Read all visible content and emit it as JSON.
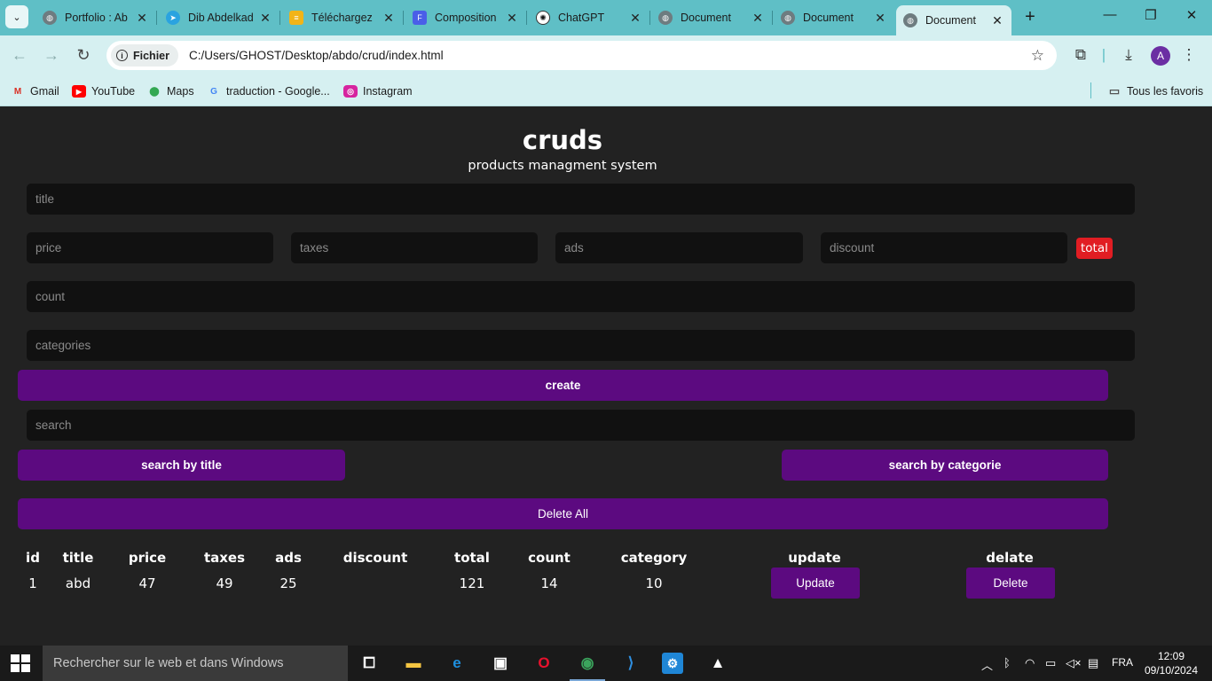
{
  "browser": {
    "tabs": [
      {
        "title": "Portfolio : Ab",
        "icon": "globe-icon",
        "active": false
      },
      {
        "title": "Dib Abdelkad",
        "icon": "telegram-icon",
        "active": false
      },
      {
        "title": "Téléchargez",
        "icon": "download-site-icon",
        "active": false
      },
      {
        "title": "Composition",
        "icon": "forms-icon",
        "active": false
      },
      {
        "title": "ChatGPT",
        "icon": "chatgpt-icon",
        "active": false
      },
      {
        "title": "Document",
        "icon": "globe-icon",
        "active": false
      },
      {
        "title": "Document",
        "icon": "globe-icon",
        "active": false
      },
      {
        "title": "Document",
        "icon": "globe-icon",
        "active": true
      }
    ],
    "address": {
      "chip_label": "Fichier",
      "url": "C:/Users/GHOST/Desktop/abdo/crud/index.html"
    },
    "profile_initial": "A",
    "bookmarks": [
      {
        "label": "Gmail",
        "icon": "gmail-icon"
      },
      {
        "label": "YouTube",
        "icon": "youtube-icon"
      },
      {
        "label": "Maps",
        "icon": "maps-icon"
      },
      {
        "label": "traduction - Google...",
        "icon": "google-icon"
      },
      {
        "label": "Instagram",
        "icon": "instagram-icon"
      }
    ],
    "all_bookmarks_label": "Tous les favoris"
  },
  "page": {
    "title": "cruds",
    "subtitle": "products managment system",
    "inputs": {
      "title_placeholder": "title",
      "price_placeholder": "price",
      "taxes_placeholder": "taxes",
      "ads_placeholder": "ads",
      "discount_placeholder": "discount",
      "count_placeholder": "count",
      "categories_placeholder": "categories",
      "search_placeholder": "search"
    },
    "total_badge": "total",
    "buttons": {
      "create": "create",
      "search_by_title": "search by title",
      "search_by_category": "search by categorie",
      "delete_all": "Delete All"
    },
    "table": {
      "headers": [
        "id",
        "title",
        "price",
        "taxes",
        "ads",
        "discount",
        "total",
        "count",
        "category",
        "update",
        "delate"
      ],
      "rows": [
        {
          "id": "1",
          "title": "abd",
          "price": "47",
          "taxes": "49",
          "ads": "25",
          "discount": "",
          "total": "121",
          "count": "14",
          "category": "10",
          "update_label": "Update",
          "delete_label": "Delete"
        }
      ]
    }
  },
  "taskbar": {
    "search_placeholder": "Rechercher sur le web et dans Windows",
    "language": "FRA",
    "time": "12:09",
    "date": "09/10/2024"
  },
  "colors": {
    "page_bg": "#222222",
    "input_bg": "#111111",
    "button_purple": "#5c0a80",
    "total_red": "#e11d23",
    "tab_strip": "#5fbfc6",
    "toolbar": "#d6f0f1"
  }
}
